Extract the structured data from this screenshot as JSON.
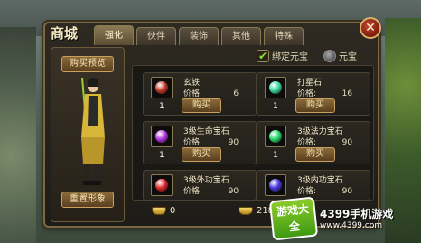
{
  "window": {
    "title": "商城",
    "close_label": "✕"
  },
  "tabs": [
    {
      "label": "强化",
      "active": true
    },
    {
      "label": "伙伴",
      "active": false
    },
    {
      "label": "装饰",
      "active": false
    },
    {
      "label": "其他",
      "active": false
    },
    {
      "label": "特殊",
      "active": false
    }
  ],
  "character_panel": {
    "preview_button": "购买预览",
    "reset_button": "重置形象"
  },
  "currency_filter": {
    "bound_label": "绑定元宝",
    "bound_checked": true,
    "yuanbao_label": "元宝",
    "check_mark": "✔"
  },
  "items": [
    {
      "name": "玄铁",
      "price_label": "价格:",
      "price": "6",
      "qty": "1",
      "buy_label": "购买",
      "gem_color": "#c23a2a"
    },
    {
      "name": "打星石",
      "price_label": "价格:",
      "price": "16",
      "qty": "1",
      "buy_label": "购买",
      "gem_color": "#3ad8a2"
    },
    {
      "name": "3级生命宝石",
      "price_label": "价格:",
      "price": "90",
      "qty": "1",
      "buy_label": "购买",
      "gem_color": "#b23ae0"
    },
    {
      "name": "3级法力宝石",
      "price_label": "价格:",
      "price": "90",
      "qty": "1",
      "buy_label": "购买",
      "gem_color": "#2ad86a"
    },
    {
      "name": "3级外功宝石",
      "price_label": "价格:",
      "price": "90",
      "qty": "1",
      "buy_label": "购买",
      "gem_color": "#e02a2a"
    },
    {
      "name": "3级内功宝石",
      "price_label": "价格:",
      "price": "90",
      "qty": "1",
      "buy_label": "购买",
      "gem_color": "#4a3ae0"
    }
  ],
  "balances": {
    "bound_amount": "0",
    "yuanbao_amount": "218"
  },
  "watermark": {
    "badge": "游戏大全",
    "title": "4399手机游戏",
    "url": "www.4399.com"
  },
  "colors": {
    "panel_border": "#7a6a44",
    "button_gold": "#c8a060",
    "check_green": "#8edc3a"
  }
}
